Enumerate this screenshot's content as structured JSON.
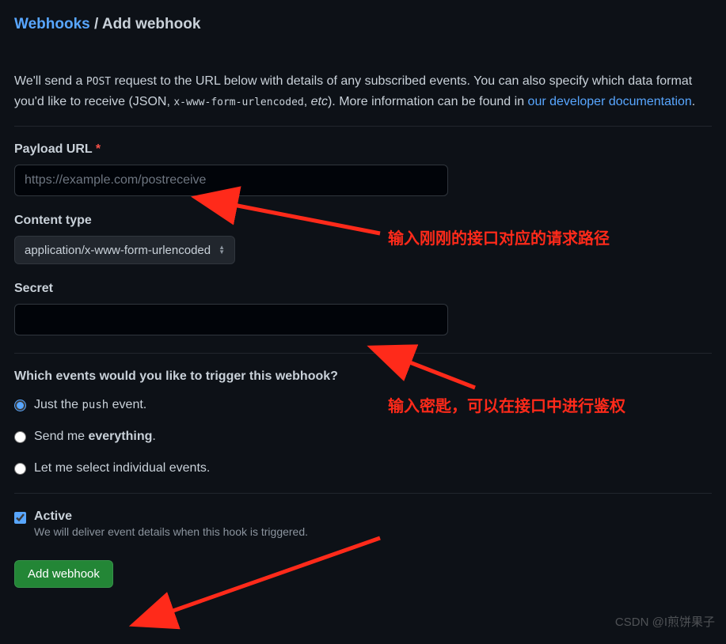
{
  "breadcrumb": {
    "link": "Webhooks",
    "sep": "/",
    "current": "Add webhook"
  },
  "intro": {
    "t1": "We'll send a ",
    "code1": "POST",
    "t2": " request to the URL below with details of any subscribed events. You can also specify which data format you'd like to receive (JSON, ",
    "code2": "x-www-form-urlencoded",
    "t3": ", ",
    "em": "etc",
    "t4": "). More information can be found in ",
    "link": "our developer documentation",
    "t5": "."
  },
  "fields": {
    "payload_label": "Payload URL",
    "payload_placeholder": "https://example.com/postreceive",
    "content_type_label": "Content type",
    "content_type_value": "application/x-www-form-urlencoded",
    "secret_label": "Secret"
  },
  "events": {
    "heading": "Which events would you like to trigger this webhook?",
    "opt1_a": "Just the ",
    "opt1_code": "push",
    "opt1_b": " event.",
    "opt2_a": "Send me ",
    "opt2_strong": "everything",
    "opt2_b": ".",
    "opt3": "Let me select individual events."
  },
  "active": {
    "label": "Active",
    "desc": "We will deliver event details when this hook is triggered."
  },
  "button": {
    "add": "Add webhook"
  },
  "annotations": {
    "a1": "输入刚刚的接口对应的请求路径",
    "a2": "输入密匙，可以在接口中进行鉴权"
  },
  "watermark": "CSDN @I煎饼果子"
}
